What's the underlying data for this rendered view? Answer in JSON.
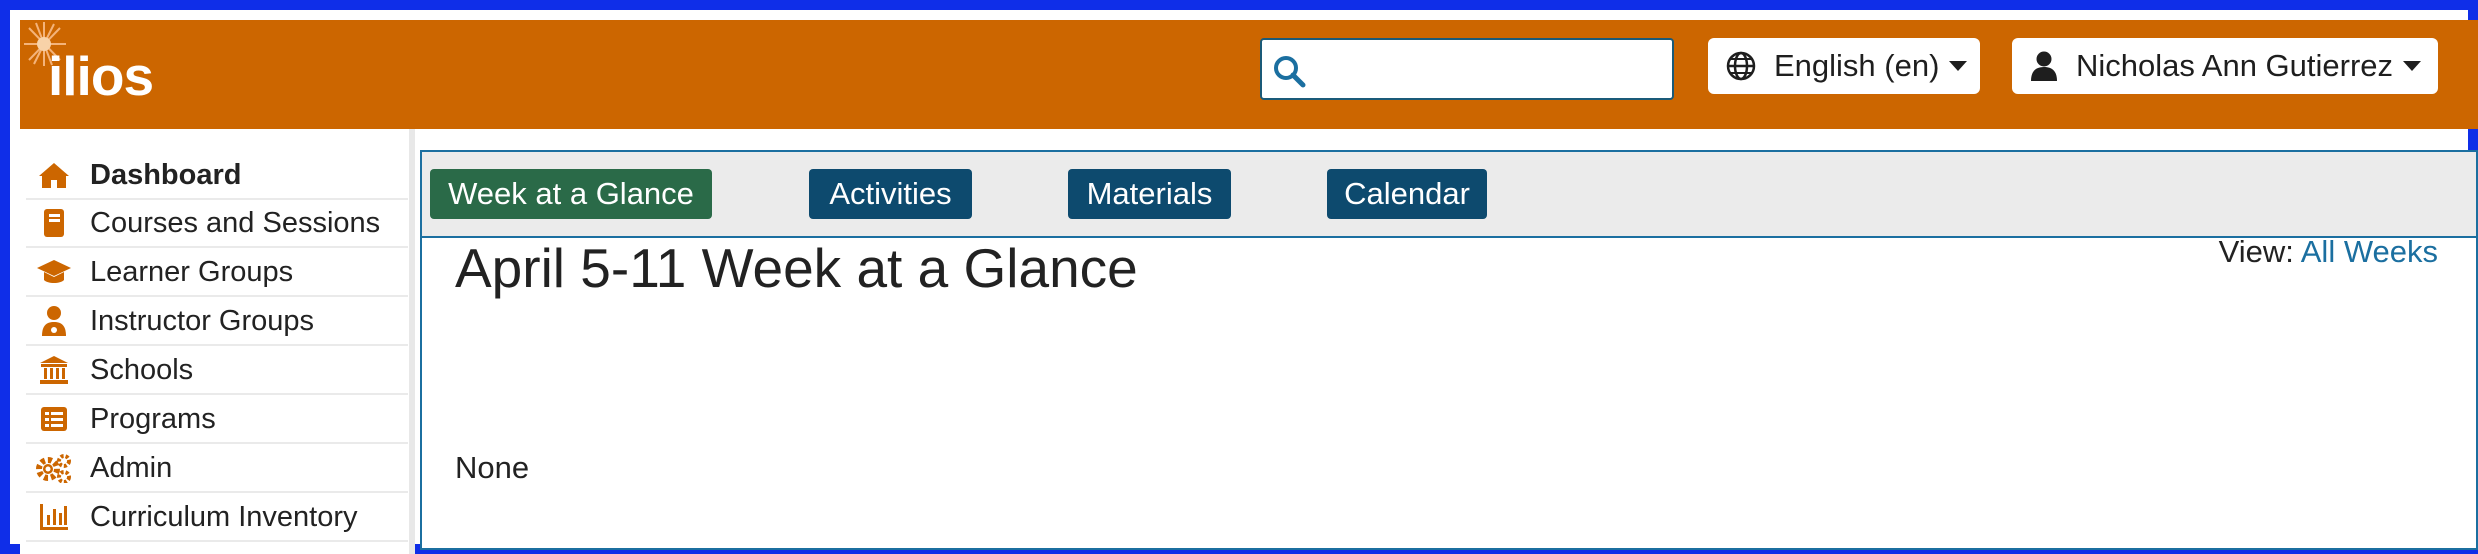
{
  "app": {
    "logo_text": "ilios"
  },
  "header": {
    "search": {
      "placeholder": "",
      "value": ""
    },
    "language": {
      "label": "English (en)",
      "icon": "globe-icon"
    },
    "user": {
      "label": "Nicholas Ann Gutierrez",
      "icon": "user-icon"
    }
  },
  "sidebar": {
    "items": [
      {
        "label": "Dashboard",
        "icon": "home-icon",
        "active": true
      },
      {
        "label": "Courses and Sessions",
        "icon": "book-icon"
      },
      {
        "label": "Learner Groups",
        "icon": "graduation-cap-icon"
      },
      {
        "label": "Instructor Groups",
        "icon": "user-md-icon"
      },
      {
        "label": "Schools",
        "icon": "university-icon"
      },
      {
        "label": "Programs",
        "icon": "list-alt-icon"
      },
      {
        "label": "Admin",
        "icon": "cogs-icon"
      },
      {
        "label": "Curriculum Inventory",
        "icon": "chart-bar-icon"
      }
    ]
  },
  "main": {
    "tabs": [
      {
        "label": "Week at a Glance",
        "active": true
      },
      {
        "label": "Activities"
      },
      {
        "label": "Materials"
      },
      {
        "label": "Calendar"
      }
    ],
    "heading": "April 5-11 Week at a Glance",
    "view_prefix": "View:",
    "view_link": "All Weeks",
    "empty_text": "None"
  },
  "colors": {
    "header_bg": "#cc6600",
    "frame": "#0f2ee8",
    "accent_icon": "#cc6600",
    "tab_active": "#2a6a48",
    "tab_inactive": "#0d4a6e",
    "link": "#1b6fa0"
  }
}
